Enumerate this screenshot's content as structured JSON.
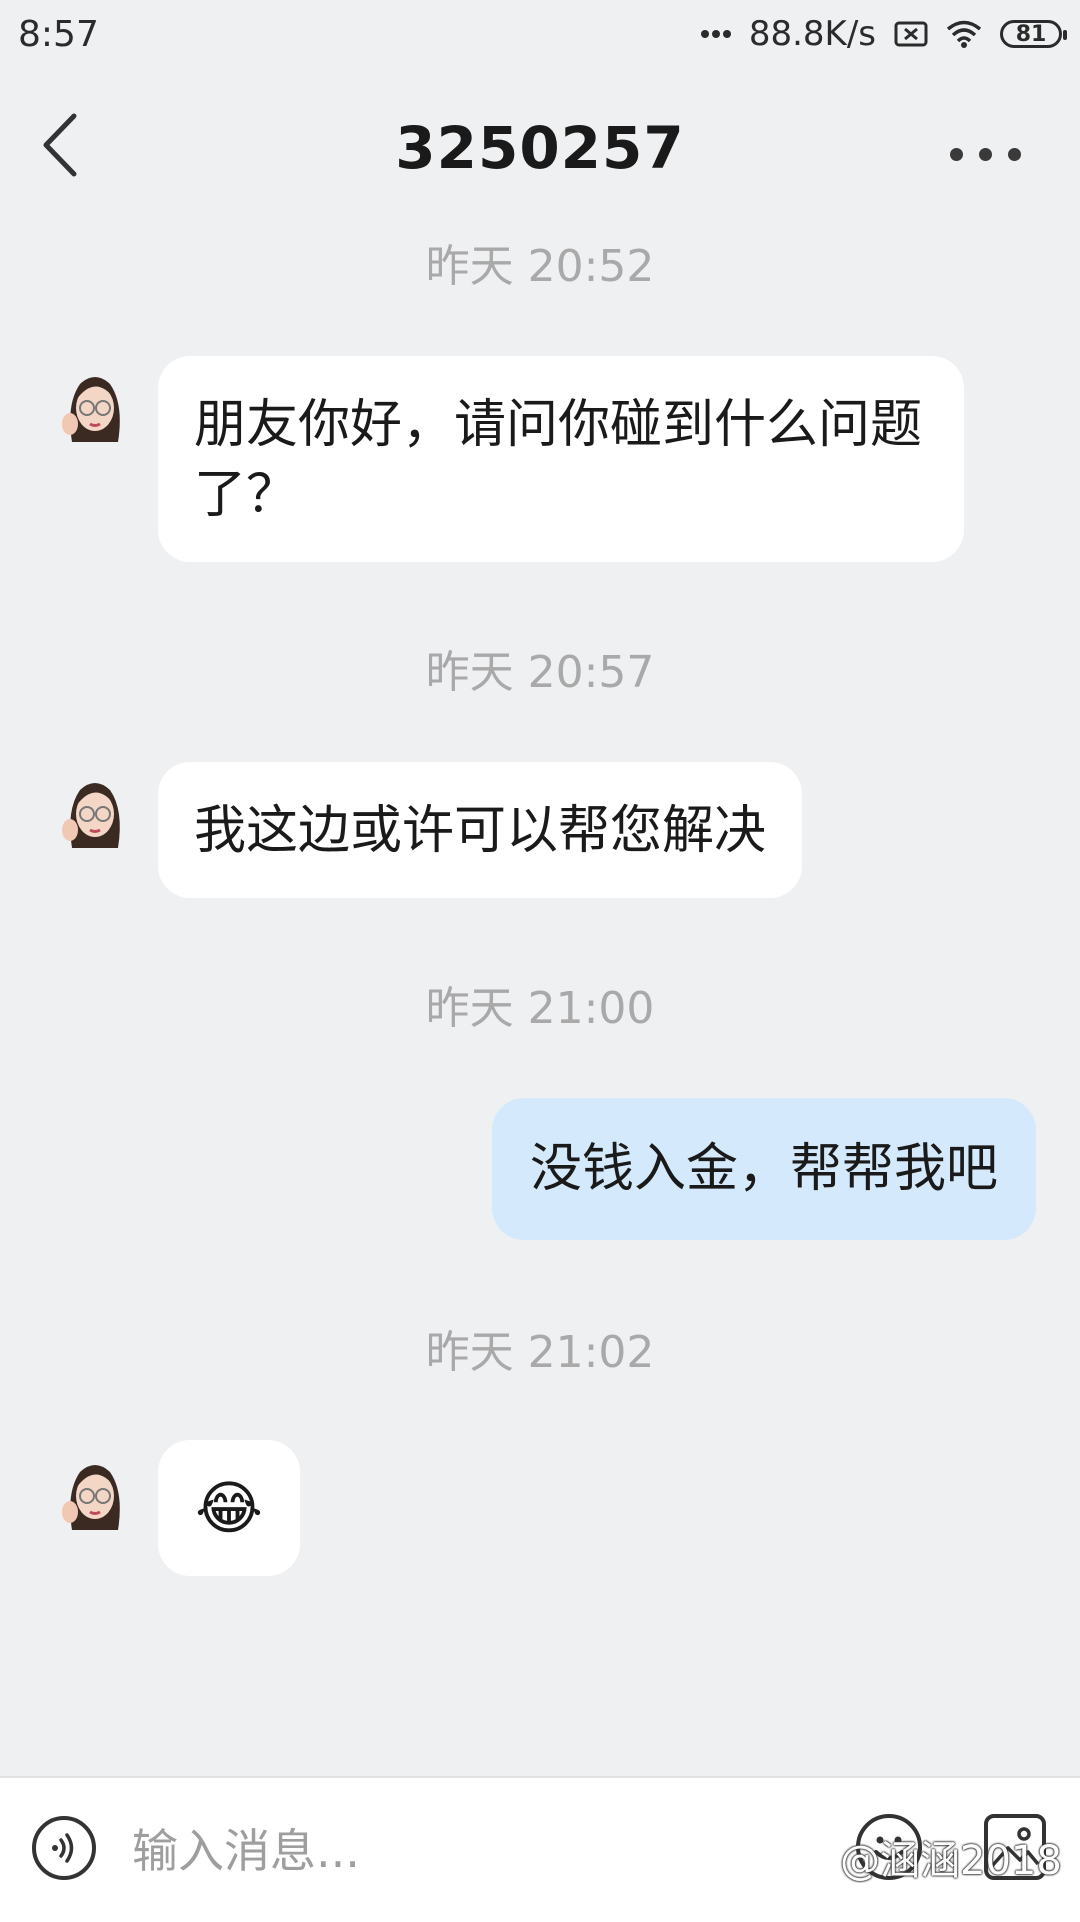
{
  "status_bar": {
    "time": "8:57",
    "net_speed": "88.8K/s",
    "battery": "81",
    "icons": [
      "more-dots-icon",
      "sim-blocked-icon",
      "wifi-icon",
      "battery-icon"
    ]
  },
  "header": {
    "title": "3250257",
    "back_icon": "chevron-left-icon",
    "more_icon": "more-horizontal-icon"
  },
  "messages": [
    {
      "time": "昨天 20:52",
      "sender": "other",
      "text": "朋友你好，请问你碰到什么问题了？"
    },
    {
      "time": "昨天 20:57",
      "sender": "other",
      "text": "我这边或许可以帮您解决"
    },
    {
      "time": "昨天 21:00",
      "sender": "me",
      "text": "没钱入金，帮帮我吧"
    },
    {
      "time": "昨天 21:02",
      "sender": "other",
      "text": "😂"
    }
  ],
  "input_bar": {
    "placeholder": "输入消息...",
    "voice_icon": "voice-icon",
    "emoji_icon": "emoji-icon",
    "image_icon": "image-icon"
  },
  "watermark": "@涵涵2018",
  "colors": {
    "background": "#eff0f2",
    "bubble_other": "#ffffff",
    "bubble_mine": "#d4e9fc",
    "timestamp": "#a9a9a9"
  }
}
